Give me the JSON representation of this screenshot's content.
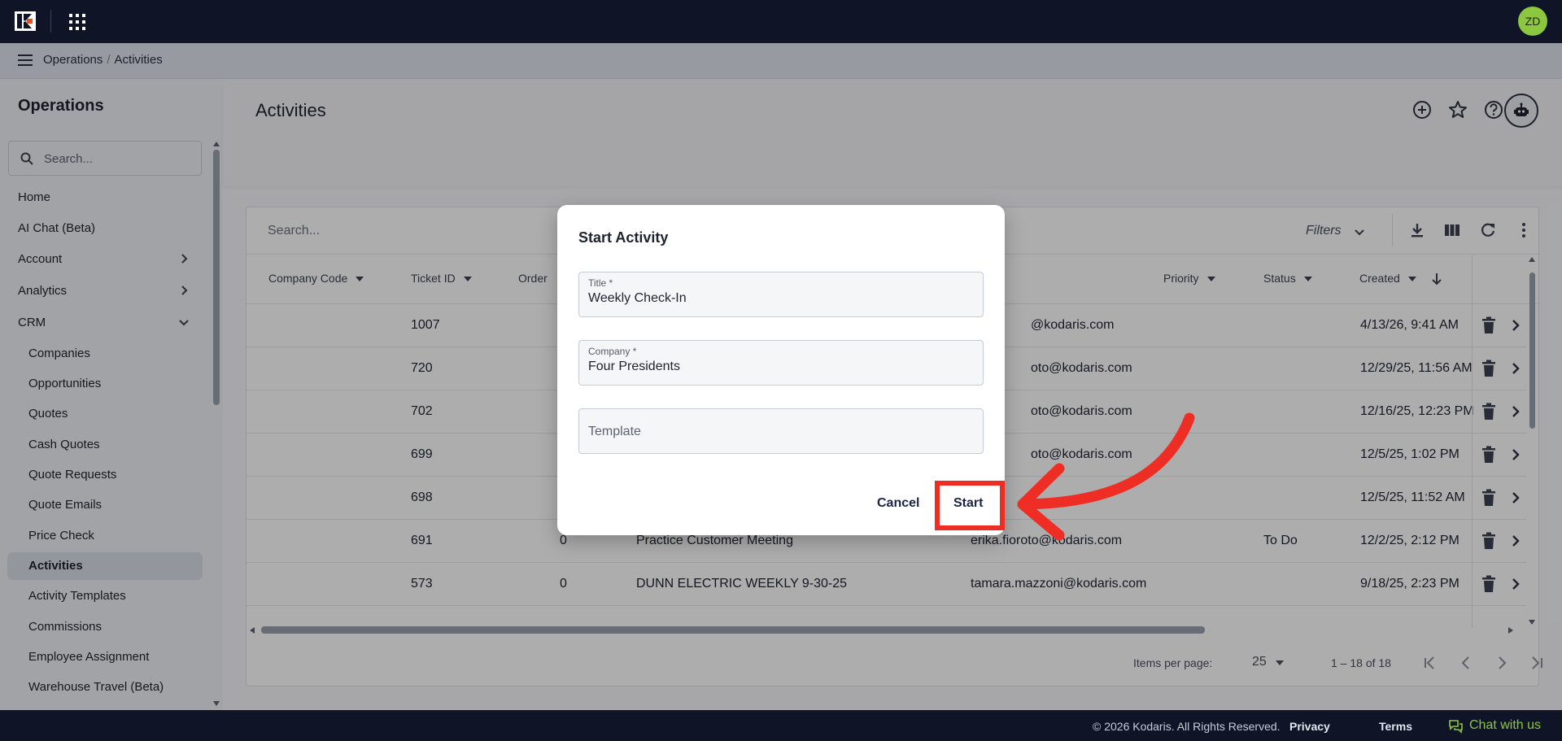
{
  "topbar": {
    "avatar_initials": "ZD"
  },
  "breadcrumb": {
    "section": "Operations",
    "separator": "/",
    "page": "Activities"
  },
  "sidebar": {
    "title": "Operations",
    "search_placeholder": "Search...",
    "items": [
      {
        "label": "Home"
      },
      {
        "label": "AI Chat (Beta)"
      },
      {
        "label": "Account"
      },
      {
        "label": "Analytics"
      },
      {
        "label": "CRM"
      }
    ],
    "crm_items": [
      {
        "label": "Companies"
      },
      {
        "label": "Opportunities"
      },
      {
        "label": "Quotes"
      },
      {
        "label": "Cash Quotes"
      },
      {
        "label": "Quote Requests"
      },
      {
        "label": "Quote Emails"
      },
      {
        "label": "Price Check"
      },
      {
        "label": "Activities"
      },
      {
        "label": "Activity Templates"
      },
      {
        "label": "Commissions"
      },
      {
        "label": "Employee Assignment"
      },
      {
        "label": "Warehouse Travel (Beta)"
      }
    ]
  },
  "page": {
    "title": "Activities"
  },
  "table": {
    "search_placeholder": "Search...",
    "filters_label": "Filters",
    "columns": [
      "Company Code",
      "Ticket ID",
      "Order",
      "Priority",
      "Status",
      "Created"
    ],
    "rows": [
      {
        "ticket": "1007",
        "order": "",
        "title": "",
        "email": "@kodaris.com",
        "status": "",
        "created": "4/13/26, 9:41 AM"
      },
      {
        "ticket": "720",
        "order": "",
        "title": "",
        "email": "oto@kodaris.com",
        "status": "",
        "created": "12/29/25, 11:56 AM"
      },
      {
        "ticket": "702",
        "order": "",
        "title": "",
        "email": "oto@kodaris.com",
        "status": "",
        "created": "12/16/25, 12:23 PM"
      },
      {
        "ticket": "699",
        "order": "",
        "title": "",
        "email": "oto@kodaris.com",
        "status": "",
        "created": "12/5/25, 1:02 PM"
      },
      {
        "ticket": "698",
        "order": "",
        "title": "",
        "email": "",
        "status": "",
        "created": "12/5/25, 11:52 AM"
      },
      {
        "ticket": "691",
        "order": "0",
        "title": "Practice Customer Meeting",
        "email": "erika.fioroto@kodaris.com",
        "status": "To Do",
        "created": "12/2/25, 2:12 PM"
      },
      {
        "ticket": "573",
        "order": "0",
        "title": "DUNN ELECTRIC WEEKLY 9-30-25",
        "email": "tamara.mazzoni@kodaris.com",
        "status": "",
        "created": "9/18/25, 2:23 PM"
      }
    ],
    "pager": {
      "items_per_page_label": "Items per page:",
      "page_size": "25",
      "range": "1 – 18 of 18"
    }
  },
  "dialog": {
    "title": "Start Activity",
    "title_field": {
      "label": "Title *",
      "value": "Weekly Check-In"
    },
    "company_field": {
      "label": "Company *",
      "value": "Four Presidents"
    },
    "template_field": {
      "placeholder": "Template"
    },
    "cancel_label": "Cancel",
    "start_label": "Start"
  },
  "footer": {
    "copyright": "© 2026 Kodaris. All Rights Reserved.",
    "privacy": "Privacy",
    "terms": "Terms",
    "chat": "Chat with us"
  },
  "colors": {
    "topbar": "#0f1526",
    "accent_green": "#8dc63f",
    "highlight_red": "#ee2e24"
  }
}
